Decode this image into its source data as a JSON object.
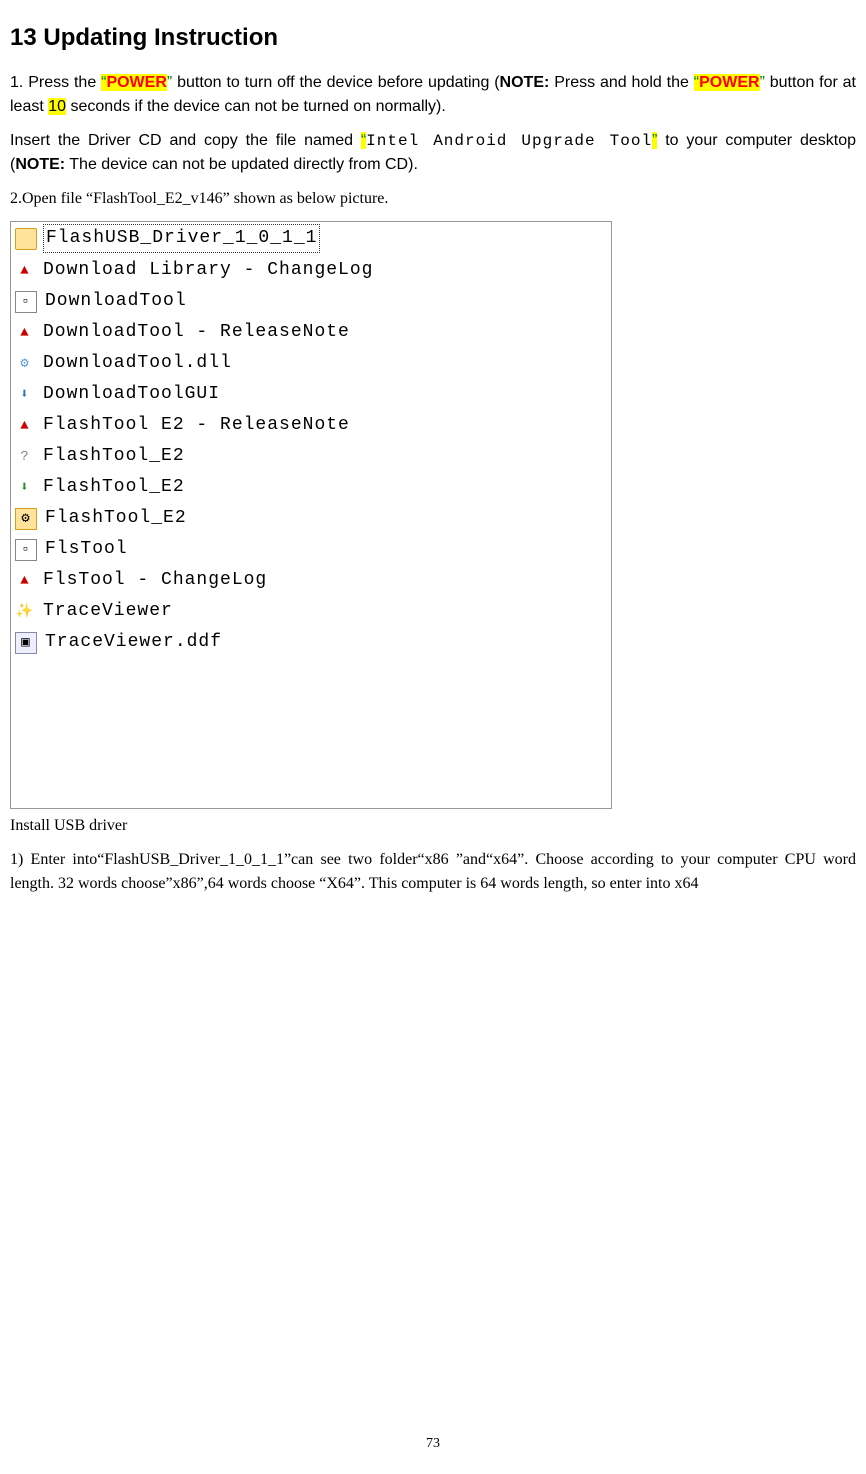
{
  "heading": "13 Updating Instruction",
  "para1_prefix": "1. Press the ",
  "quote_open": "“",
  "quote_close": "”",
  "power_label": "POWER",
  "para1_mid": " button to turn off the device before updating (",
  "note_label": "NOTE:",
  "para1_after_note": " Press and hold the ",
  "para1_mid2": " button for at least ",
  "ten": "10",
  "para1_end": " seconds if the device can not be turned on normally).",
  "para2_prefix": "Insert the Driver CD and copy the file named ",
  "tool_name": "Intel Android Upgrade Tool",
  "para2_mid": " to your computer desktop (",
  "para2_end": " The device can not be updated directly from CD).",
  "para3_prefix": "2.Open file  ",
  "flash_file": "“FlashTool_E2_v146”",
  "para3_end": "  shown as below picture.",
  "files": [
    {
      "name": "FlashUSB_Driver_1_0_1_1",
      "icon": "folder",
      "selected": true
    },
    {
      "name": "Download Library - ChangeLog",
      "icon": "pdf"
    },
    {
      "name": "DownloadTool",
      "icon": "app"
    },
    {
      "name": "DownloadTool - ReleaseNote",
      "icon": "pdf"
    },
    {
      "name": "DownloadTool.dll",
      "icon": "dll"
    },
    {
      "name": "DownloadToolGUI",
      "icon": "exe-down"
    },
    {
      "name": "FlashTool E2 - ReleaseNote",
      "icon": "pdf"
    },
    {
      "name": "FlashTool_E2",
      "icon": "chm"
    },
    {
      "name": "FlashTool_E2",
      "icon": "down-green"
    },
    {
      "name": "FlashTool_E2",
      "icon": "cfg"
    },
    {
      "name": "FlsTool",
      "icon": "app"
    },
    {
      "name": "FlsTool - ChangeLog",
      "icon": "pdf"
    },
    {
      "name": "TraceViewer",
      "icon": "yellow"
    },
    {
      "name": "TraceViewer.ddf",
      "icon": "ddf"
    }
  ],
  "install_heading": "Install USB driver",
  "para4": "1) Enter into“FlashUSB_Driver_1_0_1_1”can see two folder“x86 ”and“x64”. Choose according to your computer CPU word length. 32 words choose”x86”,64 words choose “X64”. This computer is 64 words length, so enter into x64",
  "page_number": "73",
  "icon_glyphs": {
    "folder": " ",
    "pdf": "▲",
    "app": "▫",
    "dll": "⚙",
    "exe-down": "⬇",
    "chm": "?",
    "down-green": "⬇",
    "cfg": "⚙",
    "yellow": "✨",
    "ddf": "▣"
  }
}
